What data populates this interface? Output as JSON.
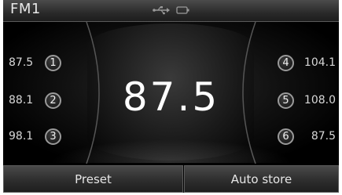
{
  "header": {
    "band": "FM1",
    "icons": [
      "usb-icon",
      "battery-icon"
    ]
  },
  "main": {
    "frequency": "87.5"
  },
  "presets": [
    {
      "number": "1",
      "frequency": "87.5"
    },
    {
      "number": "2",
      "frequency": "88.1"
    },
    {
      "number": "3",
      "frequency": "98.1"
    },
    {
      "number": "4",
      "frequency": "104.1"
    },
    {
      "number": "5",
      "frequency": "108.0"
    },
    {
      "number": "6",
      "frequency": "87.5"
    }
  ],
  "buttons": {
    "preset_label": "Preset",
    "auto_store_label": "Auto store"
  },
  "colors": {
    "background": "#000000",
    "text": "#ffffff",
    "bar": "#3a3a3a"
  }
}
